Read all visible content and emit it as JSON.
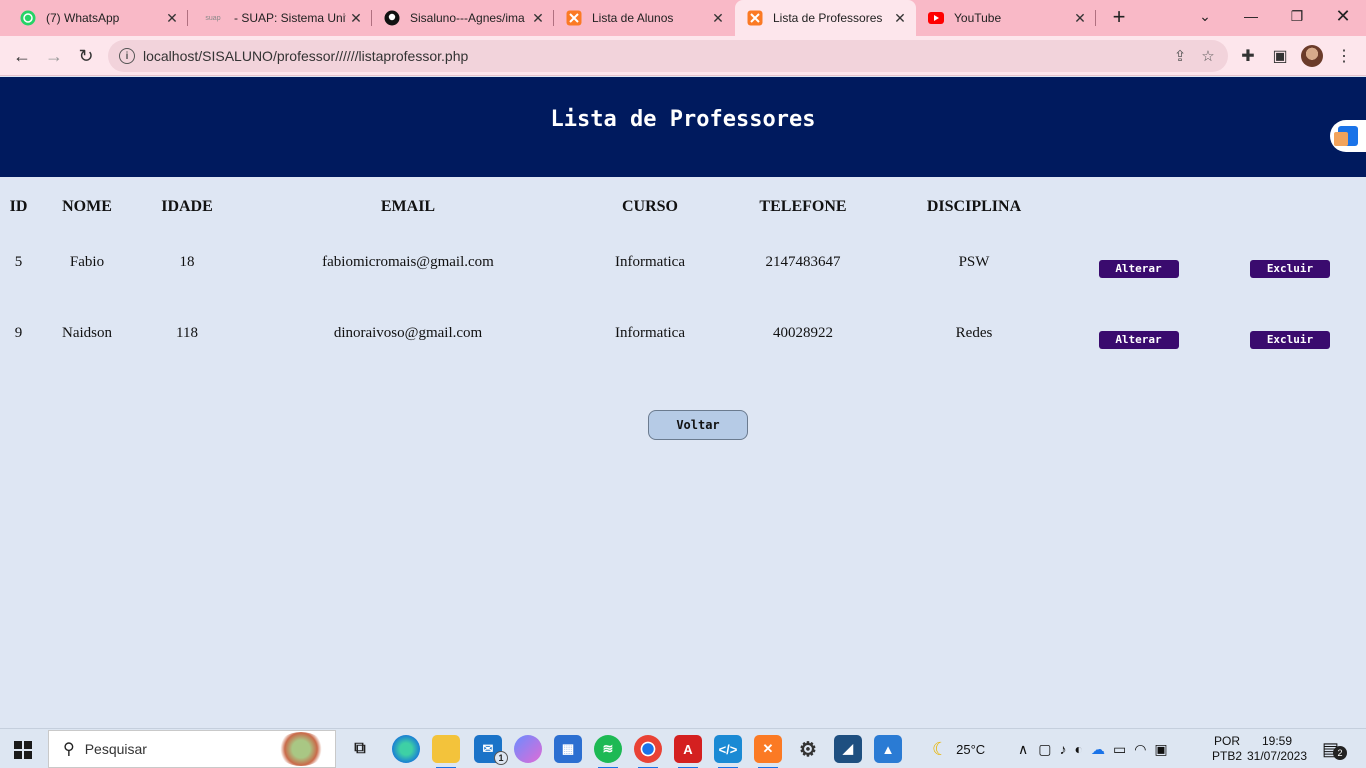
{
  "browser": {
    "tabs": [
      {
        "title": "(7) WhatsApp",
        "icon": "whatsapp-icon",
        "color": "#25d366"
      },
      {
        "title": "- SUAP: Sistema Unific",
        "icon": "suap-icon",
        "favicon_text": "suap",
        "color": "#888888"
      },
      {
        "title": "Sisaluno---Agnes/ima",
        "icon": "github-icon",
        "color": "#111111"
      },
      {
        "title": "Lista de Alunos",
        "icon": "xampp-icon",
        "color": "#fb7a24"
      },
      {
        "title": "Lista de Professores",
        "icon": "xampp-icon",
        "color": "#fb7a24"
      },
      {
        "title": "YouTube",
        "icon": "youtube-icon",
        "color": "#ff0000"
      }
    ],
    "active_tab": 4,
    "url": "localhost/SISALUNO/professor//////listaprofessor.php"
  },
  "page": {
    "title": "Lista de Professores",
    "columns": [
      "ID",
      "NOME",
      "IDADE",
      "EMAIL",
      "CURSO",
      "TELEFONE",
      "DISCIPLINA"
    ],
    "rows": [
      [
        "5",
        "Fabio",
        "18",
        "fabiomicromais@gmail.com",
        "Informatica",
        "2147483647",
        "PSW"
      ],
      [
        "9",
        "Naidson",
        "118",
        "dinoraivoso@gmail.com",
        "Informatica",
        "40028922",
        "Redes"
      ]
    ],
    "alter_label": "Alterar",
    "delete_label": "Excluir",
    "back_label": "Voltar",
    "colors": {
      "banner": "#001a5e",
      "background": "#dee6f3",
      "action_button": "#3a0b6e",
      "back_button": "#b6cbe6"
    }
  },
  "taskbar": {
    "search_placeholder": "Pesquisar",
    "weather": "25°C",
    "language": "POR",
    "keyboard": "PTB2",
    "time": "19:59",
    "date": "31/07/2023",
    "mail_badge": "1",
    "notification_count": "2",
    "apps": [
      "edge-icon",
      "file-explorer-icon",
      "mail-icon",
      "copilot-icon",
      "news-icon",
      "spotify-icon",
      "chrome-icon",
      "acrobat-icon",
      "vscode-icon",
      "xampp-icon",
      "settings-icon",
      "mysql-workbench-icon",
      "photos-icon"
    ]
  }
}
